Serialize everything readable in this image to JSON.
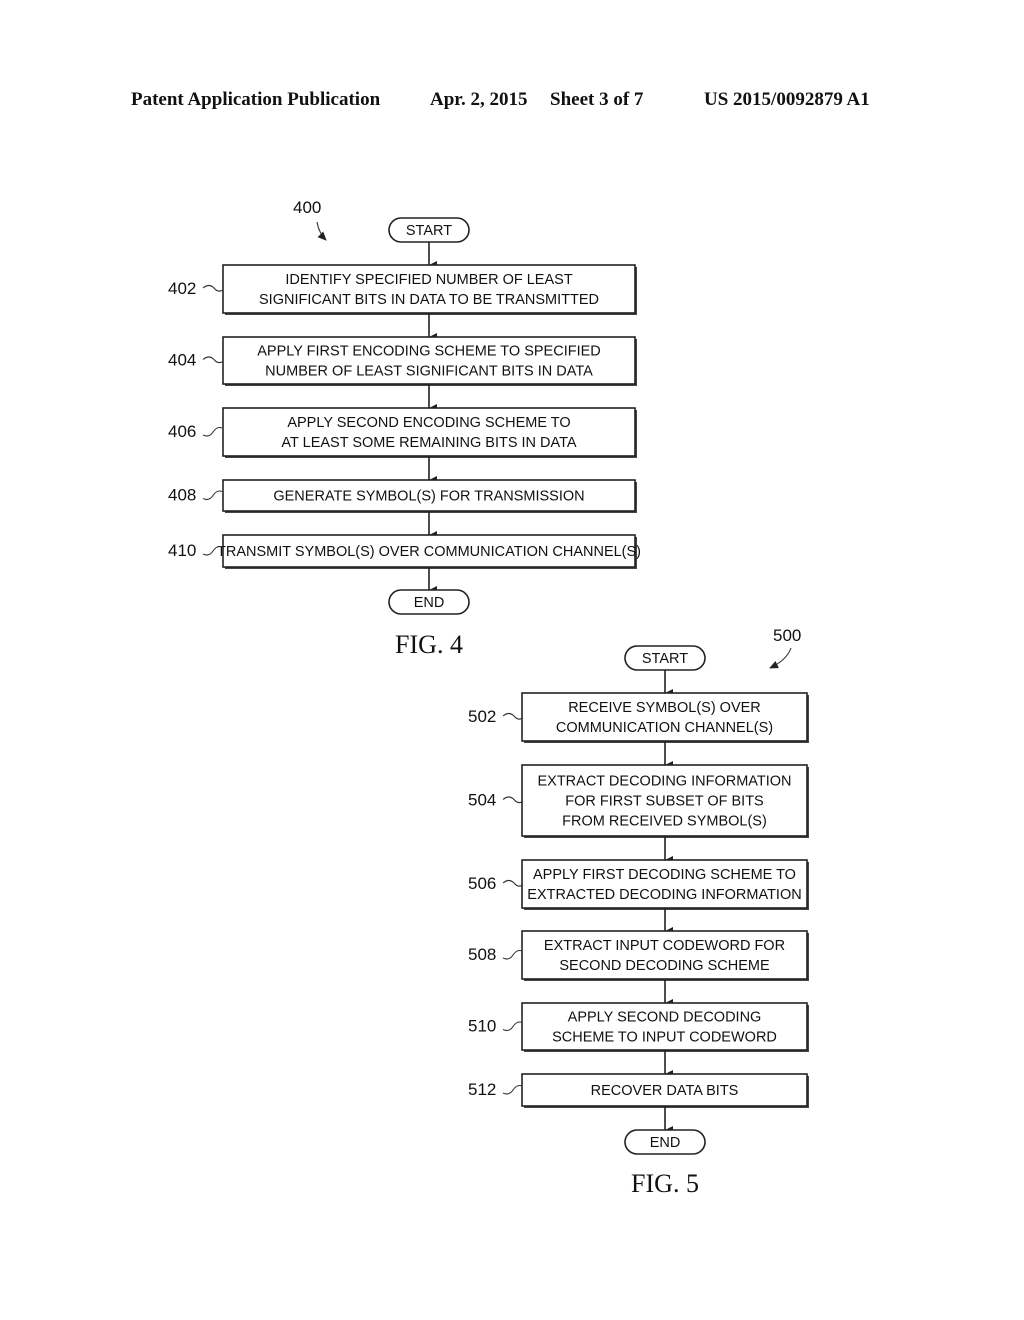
{
  "header": {
    "publication_type": "Patent Application Publication",
    "date": "Apr. 2, 2015",
    "sheet": "Sheet 3 of 7",
    "publication_number": "US 2015/0092879 A1"
  },
  "figures": [
    {
      "id": "fig4",
      "caption": "FIG. 4",
      "reference": "400",
      "start_label": "START",
      "end_label": "END",
      "steps": [
        {
          "ref": "402",
          "lines": [
            "IDENTIFY SPECIFIED NUMBER OF LEAST",
            "SIGNIFICANT BITS IN DATA TO BE TRANSMITTED"
          ]
        },
        {
          "ref": "404",
          "lines": [
            "APPLY FIRST ENCODING SCHEME TO SPECIFIED",
            "NUMBER OF LEAST SIGNIFICANT BITS IN DATA"
          ]
        },
        {
          "ref": "406",
          "lines": [
            "APPLY SECOND ENCODING SCHEME TO",
            "AT LEAST SOME REMAINING BITS IN DATA"
          ]
        },
        {
          "ref": "408",
          "lines": [
            "GENERATE SYMBOL(S) FOR TRANSMISSION"
          ]
        },
        {
          "ref": "410",
          "lines": [
            "TRANSMIT SYMBOL(S) OVER COMMUNICATION CHANNEL(S)"
          ]
        }
      ]
    },
    {
      "id": "fig5",
      "caption": "FIG. 5",
      "reference": "500",
      "start_label": "START",
      "end_label": "END",
      "steps": [
        {
          "ref": "502",
          "lines": [
            "RECEIVE SYMBOL(S) OVER",
            "COMMUNICATION CHANNEL(S)"
          ]
        },
        {
          "ref": "504",
          "lines": [
            "EXTRACT DECODING INFORMATION",
            "FOR FIRST SUBSET OF BITS",
            "FROM RECEIVED SYMBOL(S)"
          ]
        },
        {
          "ref": "506",
          "lines": [
            "APPLY FIRST DECODING SCHEME TO",
            "EXTRACTED DECODING INFORMATION"
          ]
        },
        {
          "ref": "508",
          "lines": [
            "EXTRACT INPUT CODEWORD FOR",
            "SECOND DECODING SCHEME"
          ]
        },
        {
          "ref": "510",
          "lines": [
            "APPLY SECOND DECODING",
            "SCHEME TO INPUT CODEWORD"
          ]
        },
        {
          "ref": "512",
          "lines": [
            "RECOVER DATA BITS"
          ]
        }
      ]
    }
  ]
}
